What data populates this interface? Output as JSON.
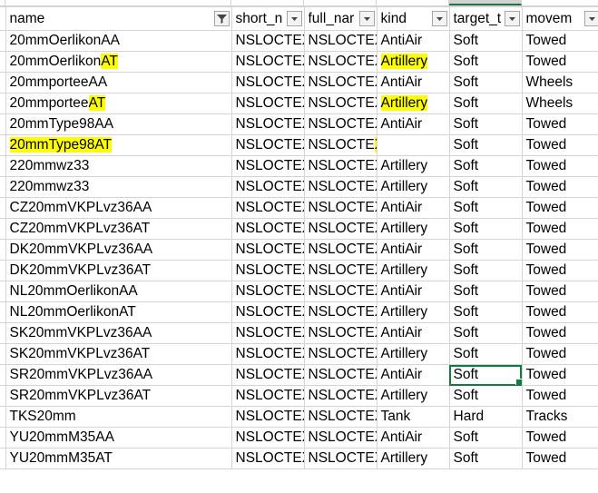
{
  "sheet": {
    "columns": [
      {
        "label": "name",
        "filter_state": "filtered"
      },
      {
        "label": "short_n",
        "filter_state": "dropdown"
      },
      {
        "label": "full_nar",
        "filter_state": "dropdown"
      },
      {
        "label": "kind",
        "filter_state": "dropdown"
      },
      {
        "label": "target_t",
        "filter_state": "dropdown"
      },
      {
        "label": "movem",
        "filter_state": "dropdown"
      }
    ],
    "rows": [
      {
        "cells": [
          {
            "text": "20mmOerlikonAA"
          },
          {
            "text": "NSLOCTEX"
          },
          {
            "text": "NSLOCTEX"
          },
          {
            "text": "AntiAir"
          },
          {
            "text": "Soft"
          },
          {
            "text": "Towed"
          }
        ]
      },
      {
        "cells": [
          {
            "text": "20mmOerlikon",
            "hl_text": "AT"
          },
          {
            "text": "NSLOCTEX"
          },
          {
            "text": "NSLOCTEX"
          },
          {
            "text": "",
            "hl_text": "Artillery"
          },
          {
            "text": "Soft"
          },
          {
            "text": "Towed"
          }
        ]
      },
      {
        "cells": [
          {
            "text": "20mmporteeAA"
          },
          {
            "text": "NSLOCTEX"
          },
          {
            "text": "NSLOCTEX"
          },
          {
            "text": "AntiAir"
          },
          {
            "text": "Soft"
          },
          {
            "text": "Wheels"
          }
        ]
      },
      {
        "cells": [
          {
            "text": "20mmportee",
            "hl_text": "AT"
          },
          {
            "text": "NSLOCTEX"
          },
          {
            "text": "NSLOCTEX"
          },
          {
            "text": "",
            "hl_text": "Artillery"
          },
          {
            "text": "Soft"
          },
          {
            "text": "Wheels"
          }
        ]
      },
      {
        "cells": [
          {
            "text": "20mmType98AA"
          },
          {
            "text": "NSLOCTEX"
          },
          {
            "text": "NSLOCTEX"
          },
          {
            "text": "AntiAir"
          },
          {
            "text": "Soft"
          },
          {
            "text": "Towed"
          }
        ]
      },
      {
        "cells": [
          {
            "text": "",
            "hl_text": "20mmType98AT"
          },
          {
            "text": "NSLOCTEX"
          },
          {
            "text": "NSLOCTE",
            "hl_text": "X AntiTank"
          },
          {
            "text": "",
            "hl_text": ""
          },
          {
            "text": "Soft"
          },
          {
            "text": "Towed"
          }
        ]
      },
      {
        "cells": [
          {
            "text": "220mmwz33"
          },
          {
            "text": "NSLOCTEX"
          },
          {
            "text": "NSLOCTEX"
          },
          {
            "text": "Artillery"
          },
          {
            "text": "Soft"
          },
          {
            "text": "Towed"
          }
        ]
      },
      {
        "cells": [
          {
            "text": "220mmwz33"
          },
          {
            "text": "NSLOCTEX"
          },
          {
            "text": "NSLOCTEX"
          },
          {
            "text": "Artillery"
          },
          {
            "text": "Soft"
          },
          {
            "text": "Towed"
          }
        ]
      },
      {
        "cells": [
          {
            "text": "CZ20mmVKPLvz36AA"
          },
          {
            "text": "NSLOCTEX"
          },
          {
            "text": "NSLOCTEX"
          },
          {
            "text": "AntiAir"
          },
          {
            "text": "Soft"
          },
          {
            "text": "Towed"
          }
        ]
      },
      {
        "cells": [
          {
            "text": "CZ20mmVKPLvz36AT"
          },
          {
            "text": "NSLOCTEX"
          },
          {
            "text": "NSLOCTEX"
          },
          {
            "text": "Artillery"
          },
          {
            "text": "Soft"
          },
          {
            "text": "Towed"
          }
        ]
      },
      {
        "cells": [
          {
            "text": "DK20mmVKPLvz36AA"
          },
          {
            "text": "NSLOCTEX"
          },
          {
            "text": "NSLOCTEX"
          },
          {
            "text": "AntiAir"
          },
          {
            "text": "Soft"
          },
          {
            "text": "Towed"
          }
        ]
      },
      {
        "cells": [
          {
            "text": "DK20mmVKPLvz36AT"
          },
          {
            "text": "NSLOCTEX"
          },
          {
            "text": "NSLOCTEX"
          },
          {
            "text": "Artillery"
          },
          {
            "text": "Soft"
          },
          {
            "text": "Towed"
          }
        ]
      },
      {
        "cells": [
          {
            "text": "NL20mmOerlikonAA"
          },
          {
            "text": "NSLOCTEX"
          },
          {
            "text": "NSLOCTEX"
          },
          {
            "text": "AntiAir"
          },
          {
            "text": "Soft"
          },
          {
            "text": "Towed"
          }
        ]
      },
      {
        "cells": [
          {
            "text": "NL20mmOerlikonAT"
          },
          {
            "text": "NSLOCTEX"
          },
          {
            "text": "NSLOCTEX"
          },
          {
            "text": "Artillery"
          },
          {
            "text": "Soft"
          },
          {
            "text": "Towed"
          }
        ]
      },
      {
        "cells": [
          {
            "text": "SK20mmVKPLvz36AA"
          },
          {
            "text": "NSLOCTEX"
          },
          {
            "text": "NSLOCTEX"
          },
          {
            "text": "AntiAir"
          },
          {
            "text": "Soft"
          },
          {
            "text": "Towed"
          }
        ]
      },
      {
        "cells": [
          {
            "text": "SK20mmVKPLvz36AT"
          },
          {
            "text": "NSLOCTEX"
          },
          {
            "text": "NSLOCTEX"
          },
          {
            "text": "Artillery"
          },
          {
            "text": "Soft"
          },
          {
            "text": "Towed"
          }
        ]
      },
      {
        "cells": [
          {
            "text": "SR20mmVKPLvz36AA"
          },
          {
            "text": "NSLOCTEX"
          },
          {
            "text": "NSLOCTEX"
          },
          {
            "text": "AntiAir"
          },
          {
            "text": "Soft"
          },
          {
            "text": "Towed"
          }
        ]
      },
      {
        "cells": [
          {
            "text": "SR20mmVKPLvz36AT"
          },
          {
            "text": "NSLOCTEX"
          },
          {
            "text": "NSLOCTEX"
          },
          {
            "text": "Artillery"
          },
          {
            "text": "Soft"
          },
          {
            "text": "Towed"
          }
        ]
      },
      {
        "cells": [
          {
            "text": "TKS20mm"
          },
          {
            "text": "NSLOCTEX"
          },
          {
            "text": "NSLOCTEX"
          },
          {
            "text": "Tank"
          },
          {
            "text": "Hard"
          },
          {
            "text": "Tracks"
          }
        ]
      },
      {
        "cells": [
          {
            "text": "YU20mmM35AA"
          },
          {
            "text": "NSLOCTEX"
          },
          {
            "text": "NSLOCTEX"
          },
          {
            "text": "AntiAir"
          },
          {
            "text": "Soft"
          },
          {
            "text": "Towed"
          }
        ]
      },
      {
        "cells": [
          {
            "text": "YU20mmM35AT"
          },
          {
            "text": "NSLOCTEX"
          },
          {
            "text": "NSLOCTEX"
          },
          {
            "text": "Artillery"
          },
          {
            "text": "Soft"
          },
          {
            "text": "Towed"
          }
        ]
      }
    ],
    "active_cell": {
      "row": 16,
      "col": 4
    },
    "selected_column": 4
  },
  "colors": {
    "highlight": "#ffff00",
    "gridline": "#d4d4d4",
    "selection": "#107c41",
    "header_bg": "#ffffff"
  },
  "icons": {
    "filter_active": "filter-funnel-icon",
    "filter_dropdown": "dropdown-arrow-icon"
  }
}
